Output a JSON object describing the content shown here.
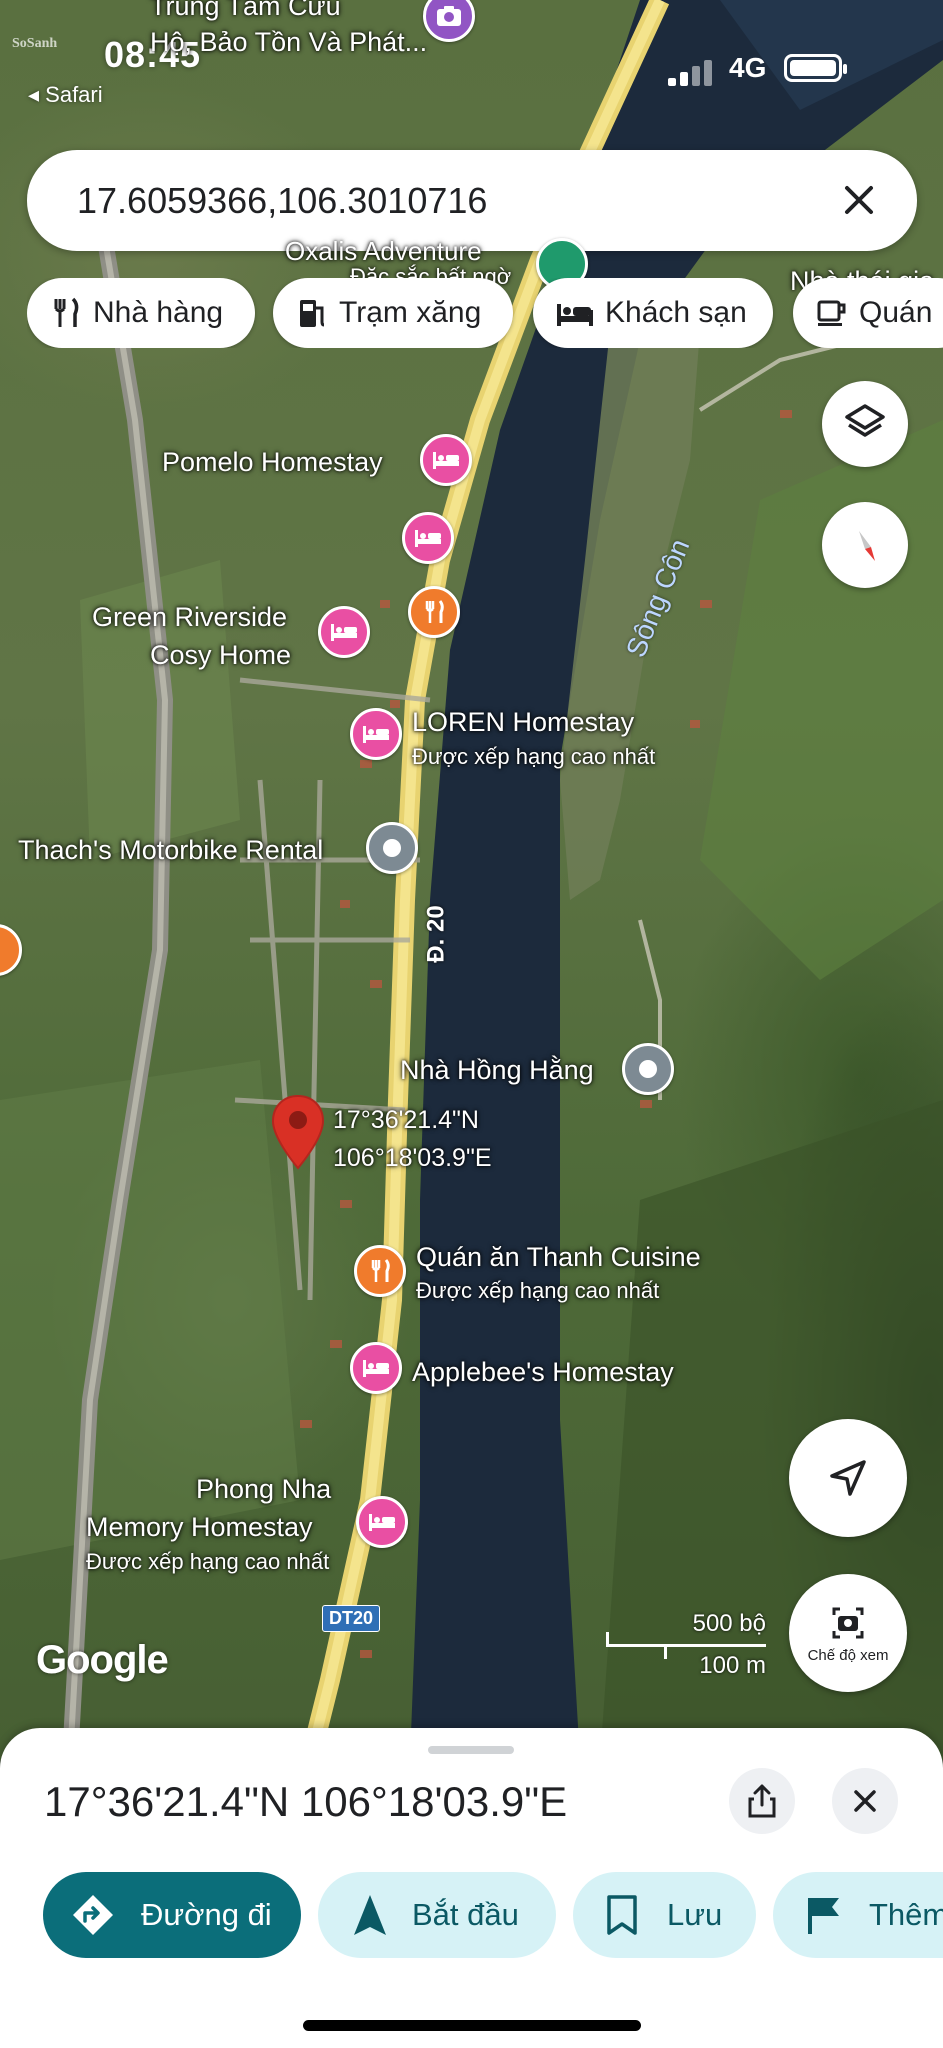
{
  "status": {
    "time": "08:45",
    "back_app": "◂ Safari",
    "network": "4G",
    "watermark": "SoSanh"
  },
  "search": {
    "query": "17.6059366,106.3010716"
  },
  "chips": [
    {
      "label": "Nhà hàng",
      "icon": "fork-knife-icon"
    },
    {
      "label": "Trạm xăng",
      "icon": "gas-station-icon"
    },
    {
      "label": "Khách sạn",
      "icon": "bed-icon"
    },
    {
      "label": "Quán",
      "icon": "cup-icon"
    }
  ],
  "map": {
    "places": {
      "top_poi": "Trung Tâm Cứu\nHộ, Bảo Tồn Và Phát...",
      "oxalis": "Oxalis Adventure",
      "oxalis_sub": "Đặc sắc bất ngờ",
      "nha_thai_gia": "Nhà thái gia",
      "pomelo": "Pomelo Homestay",
      "green_riverside_1": "Green Riverside",
      "green_riverside_2": "Cosy Home",
      "loren": "LOREN Homestay",
      "loren_sub": "Được xếp hạng cao nhất",
      "thach": "Thach's Motorbike Rental",
      "hong_hang": "Nhà Hồng Hằng",
      "dropped_lat": "17°36'21.4\"N",
      "dropped_lon": "106°18'03.9\"E",
      "thanh": "Quán ăn Thanh Cuisine",
      "thanh_sub": "Được xếp hạng cao nhất",
      "applebee": "Applebee's Homestay",
      "phong_nha_1": "Phong Nha",
      "phong_nha_2": "Memory Homestay",
      "phong_nha_sub": "Được xếp hạng cao nhất"
    },
    "road_label": "Đ. 20",
    "river_label": "Sông Côn",
    "route_shield": "DT20",
    "attribution": "Google",
    "scale_top": "500 bộ",
    "scale_bottom": "100 m",
    "camera_mode_label": "Chế độ xem"
  },
  "sheet": {
    "title": "17°36'21.4\"N 106°18'03.9\"E",
    "actions": [
      {
        "label": "Đường đi",
        "icon": "directions-icon"
      },
      {
        "label": "Bắt đầu",
        "icon": "navigation-arrow-icon"
      },
      {
        "label": "Lưu",
        "icon": "bookmark-icon"
      },
      {
        "label": "Thêm",
        "icon": "flag-icon"
      }
    ]
  },
  "colors": {
    "primary": "#0b6e7a",
    "secondary": "#d6f2f6",
    "hotel_pin": "#e94fa3",
    "food_pin": "#f07b2c",
    "pin_red": "#d93025"
  }
}
